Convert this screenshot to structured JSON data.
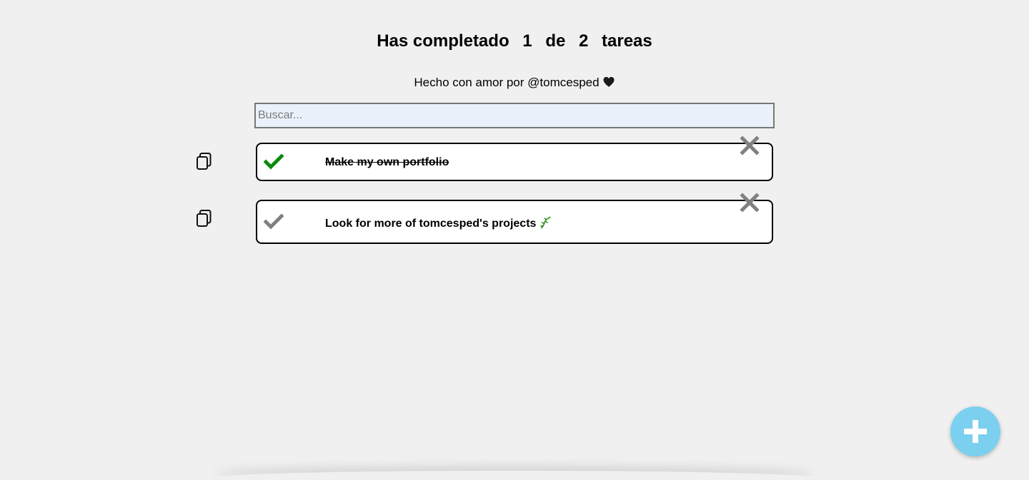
{
  "header": {
    "prefix": "Has completado",
    "completed": "1",
    "of_word": "de",
    "total": "2",
    "suffix": "tareas",
    "credit": "Hecho con amor por @tomcesped"
  },
  "search": {
    "placeholder": "Buscar...",
    "value": ""
  },
  "todos": [
    {
      "text": "Make my own portfolio",
      "completed": true
    },
    {
      "text": "Look for more of tomcesped's projects",
      "completed": false
    }
  ],
  "colors": {
    "background": "#f0f0f0",
    "check_done": "#0a8a0a",
    "check_pending": "#808080",
    "delete": "#808080",
    "fab": "#7bd0ef",
    "search_bg": "#eaf1fb"
  },
  "icons": {
    "copy": "copy-icon",
    "check": "check-icon",
    "delete": "close-icon",
    "add": "plus-icon",
    "heart": "black-heart-icon",
    "lizard": "lizard-icon"
  }
}
